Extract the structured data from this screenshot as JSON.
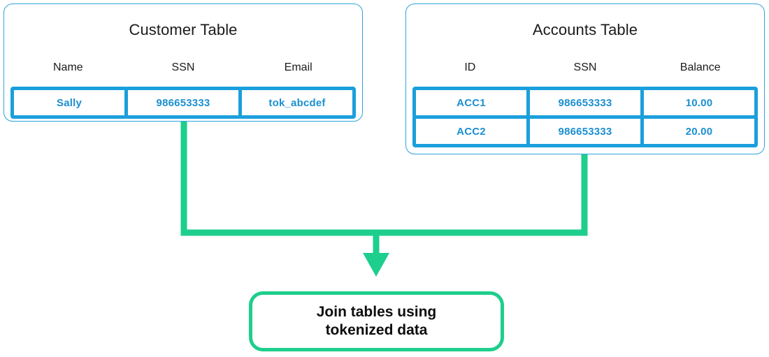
{
  "diagram": {
    "accent_blue": "#1b9fdc",
    "accent_green": "#1ece8c",
    "text_dark": "#1b1b1b",
    "cell_text_blue": "#1b8fd0"
  },
  "customer_table": {
    "title": "Customer Table",
    "columns": [
      "Name",
      "SSN",
      "Email"
    ],
    "rows": [
      [
        "Sally",
        "986653333",
        "tok_abcdef"
      ]
    ]
  },
  "accounts_table": {
    "title": "Accounts Table",
    "columns": [
      "ID",
      "SSN",
      "Balance"
    ],
    "rows": [
      [
        "ACC1",
        "986653333",
        "10.00"
      ],
      [
        "ACC2",
        "986653333",
        "20.00"
      ]
    ]
  },
  "outcome": {
    "text": "Join tables using\ntokenized data"
  }
}
